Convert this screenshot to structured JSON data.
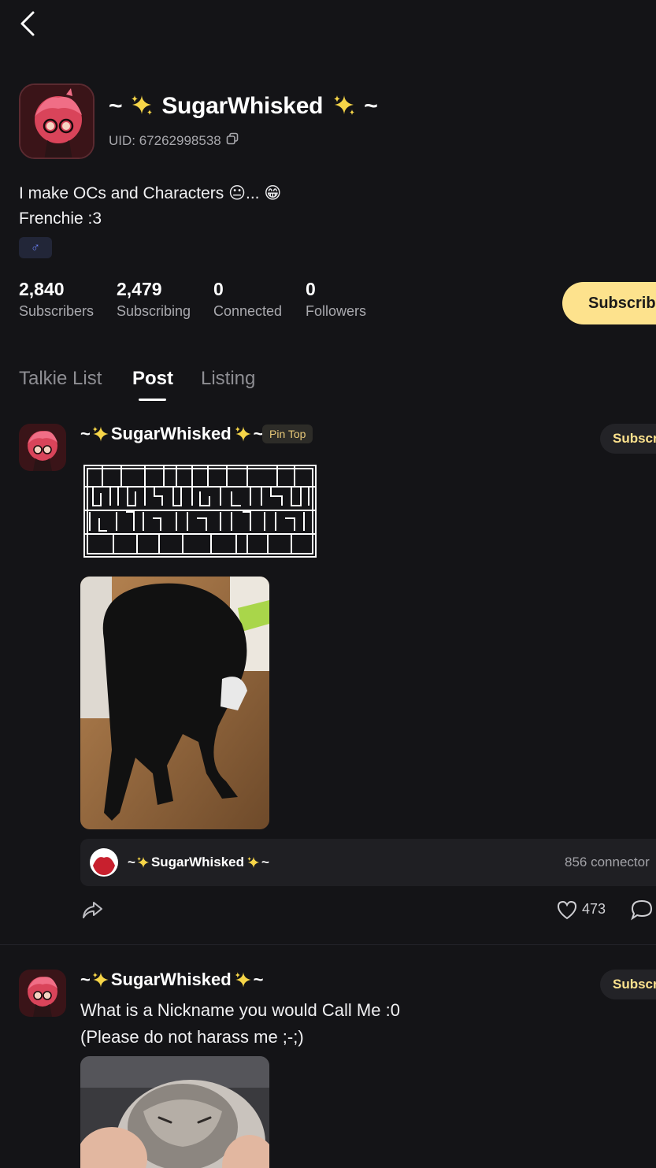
{
  "profile": {
    "name_prefix": "~",
    "name": "SugarWhisked",
    "name_suffix": "~",
    "uid": "UID: 67262998538",
    "bio_line1": "I make OCs and Characters 😐... 😁",
    "bio_line2": "Frenchie :3",
    "gender_symbol": "♂",
    "subscribe_label": "Subscrib"
  },
  "stats": [
    {
      "value": "2,840",
      "label": "Subscribers"
    },
    {
      "value": "2,479",
      "label": "Subscribing"
    },
    {
      "value": "0",
      "label": "Connected"
    },
    {
      "value": "0",
      "label": "Followers"
    }
  ],
  "tabs": [
    {
      "label": "Talkie List"
    },
    {
      "label": "Post"
    },
    {
      "label": "Listing"
    }
  ],
  "posts": [
    {
      "author_prefix": "~",
      "author": "SugarWhisked",
      "author_suffix": "~",
      "pin_label": "Pin Top",
      "subscribe_label": "Subscr",
      "image_desc": "person in black morphsuit crouching on wood floor",
      "talkie_prefix": "~",
      "talkie_name": "SugarWhisked",
      "talkie_suffix": "~",
      "connectors": "856 connector",
      "likes": "473"
    },
    {
      "author_prefix": "~",
      "author": "SugarWhisked",
      "author_suffix": "~",
      "subscribe_label": "Subscr",
      "text_line1": "What is a Nickname you would Call Me :0",
      "text_line2": "(Please do not harass me ;-;)"
    }
  ],
  "colors": {
    "background": "#141417",
    "accent": "#fde28d",
    "pin_text": "#e8c979",
    "muted": "#a9a9ae"
  }
}
